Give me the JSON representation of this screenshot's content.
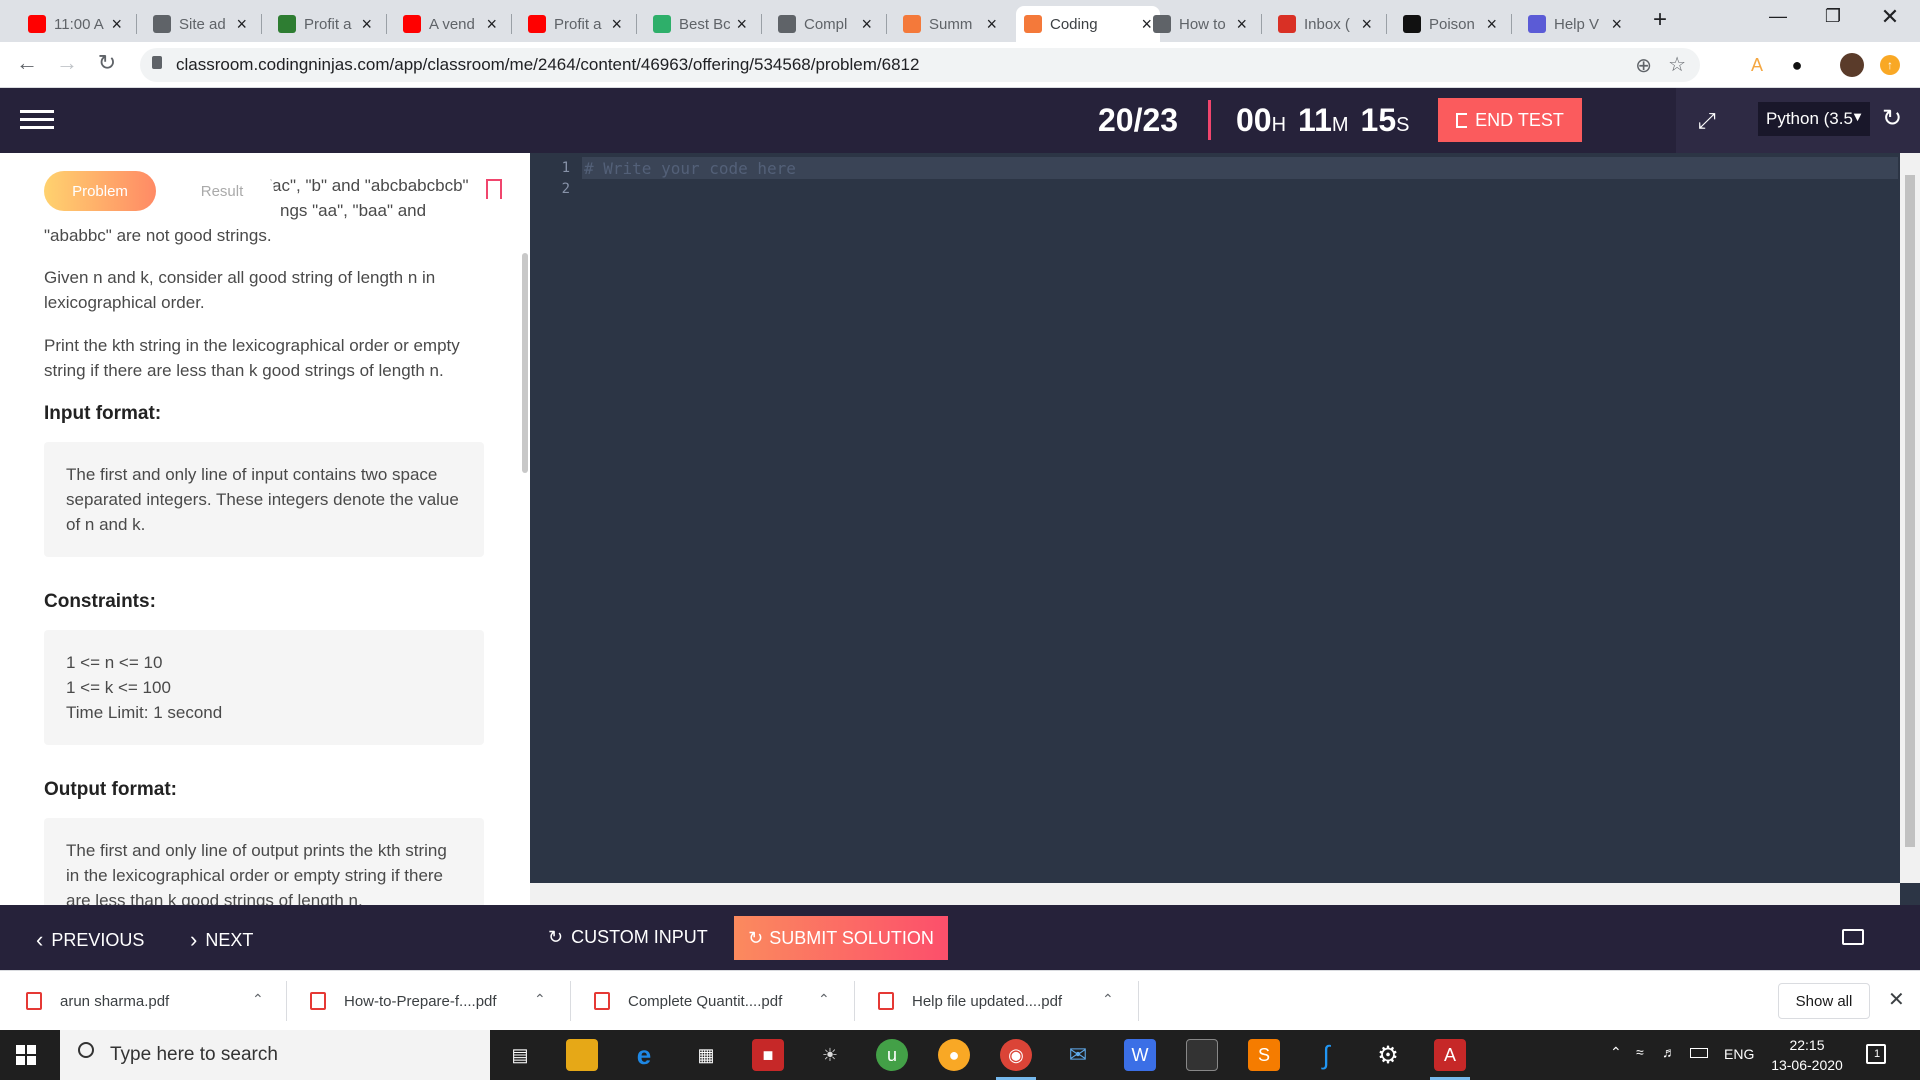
{
  "browser": {
    "tabs": [
      {
        "title": "11:00 A",
        "icon": "youtube-icon",
        "color": "#ff0000"
      },
      {
        "title": "Site ad",
        "icon": "globe-icon",
        "color": "#5f6368"
      },
      {
        "title": "Profit a",
        "icon": "leaf-icon",
        "color": "#2e7d32"
      },
      {
        "title": "A vend",
        "icon": "youtube-icon",
        "color": "#ff0000"
      },
      {
        "title": "Profit a",
        "icon": "youtube-icon",
        "color": "#ff0000"
      },
      {
        "title": "Best Bc",
        "icon": "eb-icon",
        "color": "#2eaf6a"
      },
      {
        "title": "Compl",
        "icon": "globe-icon",
        "color": "#5f6368"
      },
      {
        "title": "Summ",
        "icon": "codingninjas-icon",
        "color": "#f4793a"
      },
      {
        "title": "Coding",
        "icon": "codingninjas-icon",
        "color": "#f4793a"
      },
      {
        "title": "How to",
        "icon": "globe-icon",
        "color": "#5f6368"
      },
      {
        "title": "Inbox (",
        "icon": "gmail-icon",
        "color": "#d93025"
      },
      {
        "title": "Poison",
        "icon": "hr-icon",
        "color": "#111111"
      },
      {
        "title": "Help V",
        "icon": "help-icon",
        "color": "#5b5bd6"
      }
    ],
    "url": "classroom.codingninjas.com/app/classroom/me/2464/content/46963/offering/534568/problem/6812"
  },
  "header": {
    "progress": "20/23",
    "timer_h": "00",
    "timer_h_unit": "H",
    "timer_m": "11",
    "timer_m_unit": "M",
    "timer_s": "15",
    "timer_s_unit": "S",
    "end_test": "END TEST",
    "language": "Python (3.5"
  },
  "problem": {
    "tab_problem": "Problem",
    "tab_result": "Result",
    "intro_fragment_1": "\"ac\", \"b\" and \"abcbabcbcb\"",
    "intro_fragment_2": "ngs \"aa\", \"baa\" and",
    "intro_fragment_3": "\"ababbc\" are not good strings.",
    "para1": "Given n and k, consider all good string of length n in lexicographical order.",
    "para2": "Print the kth string in the lexicographical order or empty string if there are less than k good strings of length n.",
    "input_heading": "Input format:",
    "input_text": "The first and only line of input contains two space separated integers. These integers denote the value of n and k.",
    "constraints_heading": "Constraints:",
    "constraints": [
      "1 <= n <= 10",
      "1 <= k <= 100",
      "Time Limit: 1 second"
    ],
    "output_heading": "Output format:",
    "output_text": "The first and only line of output prints the kth string in the lexicographical order or empty string if there are less than k good strings of length n."
  },
  "editor": {
    "line_numbers": [
      "1",
      "2"
    ],
    "code_line1": "# Write your code here"
  },
  "actions": {
    "previous": "PREVIOUS",
    "next": "NEXT",
    "custom_input": "CUSTOM INPUT",
    "submit": "SUBMIT SOLUTION"
  },
  "downloads": {
    "files": [
      "arun sharma.pdf",
      "How-to-Prepare-f....pdf",
      "Complete Quantit....pdf",
      "Help file updated....pdf"
    ],
    "show_all": "Show all"
  },
  "taskbar": {
    "search_placeholder": "Type here to search",
    "language": "ENG",
    "time": "22:15",
    "date": "13-06-2020",
    "notifications": "1"
  }
}
